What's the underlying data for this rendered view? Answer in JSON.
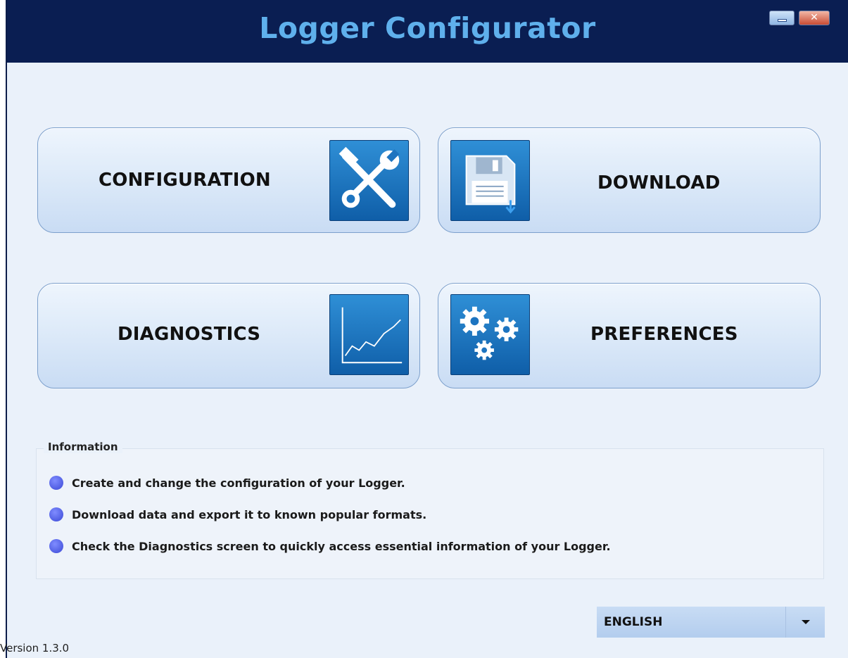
{
  "window": {
    "title": "Logger Configurator",
    "minimize_icon": "minimize-icon",
    "close_label": "✕"
  },
  "tiles": {
    "configuration": {
      "label": "CONFIGURATION",
      "icon": "tools-icon"
    },
    "download": {
      "label": "DOWNLOAD",
      "icon": "floppy-disk-icon"
    },
    "diagnostics": {
      "label": "DIAGNOSTICS",
      "icon": "line-chart-icon"
    },
    "preferences": {
      "label": "PREFERENCES",
      "icon": "gears-icon"
    }
  },
  "information": {
    "title": "Information",
    "items": [
      "Create and change the configuration of your Logger.",
      "Download data and export it to known popular formats.",
      "Check the Diagnostics screen to quickly access essential information of your Logger."
    ]
  },
  "language": {
    "selected": "ENGLISH"
  },
  "footer": {
    "version": "Version 1.3.0"
  },
  "colors": {
    "titlebar": "#0a1e52",
    "title_text": "#5fb0ec",
    "icon_blue": "#1b73bf",
    "bullet": "#4a56e0"
  }
}
